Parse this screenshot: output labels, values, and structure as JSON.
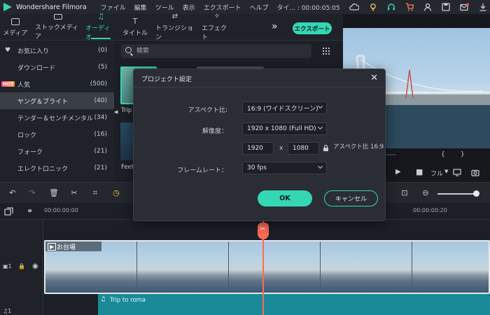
{
  "app": {
    "name": "Wondershare Filmora",
    "menu": [
      "ファイル",
      "編集",
      "ツール",
      "表示",
      "エクスポート",
      "ヘルプ",
      "タイ... : 00:00:05:05"
    ]
  },
  "nav": {
    "tabs": [
      {
        "label": "メディア",
        "active": false
      },
      {
        "label": "ストックメディア",
        "active": false
      },
      {
        "label": "オーディオ",
        "active": true
      },
      {
        "label": "タイトル",
        "active": false
      },
      {
        "label": "トランジション",
        "active": false
      },
      {
        "label": "エフェクト",
        "active": false
      }
    ],
    "export_label": "エクスポート",
    "more_label": "»"
  },
  "sidebar": {
    "items": [
      {
        "label": "お気に入り",
        "count": "(0)",
        "badge": "heart"
      },
      {
        "label": "ダウンロード",
        "count": "(5)"
      },
      {
        "label": "人気",
        "count": "(500)",
        "badge": "HOT"
      },
      {
        "label": "ヤング＆ブライト",
        "count": "(40)",
        "active": true
      },
      {
        "label": "テンダー＆センチメンタル",
        "count": "(34)"
      },
      {
        "label": "ロック",
        "count": "(16)"
      },
      {
        "label": "フォーク",
        "count": "(21)"
      },
      {
        "label": "エレクトロニック",
        "count": "(21)"
      }
    ]
  },
  "media": {
    "search_placeholder": "検索",
    "thumb_labels": [
      "Trip",
      "Feet"
    ]
  },
  "preview": {
    "quality_label": "フル"
  },
  "timeline": {
    "time_start": "00:00:00:00",
    "time_mid": "00:00:00:20",
    "video_clip_label": "お台場",
    "audio_clip_label": "Trip to roma"
  },
  "dialog": {
    "title": "プロジェクト設定",
    "aspect_label": "アスペクト比:",
    "aspect_value": "16:9 (ワイドスクリーン)",
    "resolution_label": "解像度：",
    "resolution_value": "1920 x 1080 (Full HD)",
    "width_value": "1920",
    "x_label": "x",
    "height_value": "1080",
    "ratio_text": "アスペクト比 16:9",
    "framerate_label": "フレームレート：",
    "framerate_value": "30 fps",
    "ok_label": "OK",
    "cancel_label": "キャンセル"
  },
  "colors": {
    "accent": "#35d6b4",
    "playhead": "#ff6b55",
    "audio": "#1a8a99"
  }
}
